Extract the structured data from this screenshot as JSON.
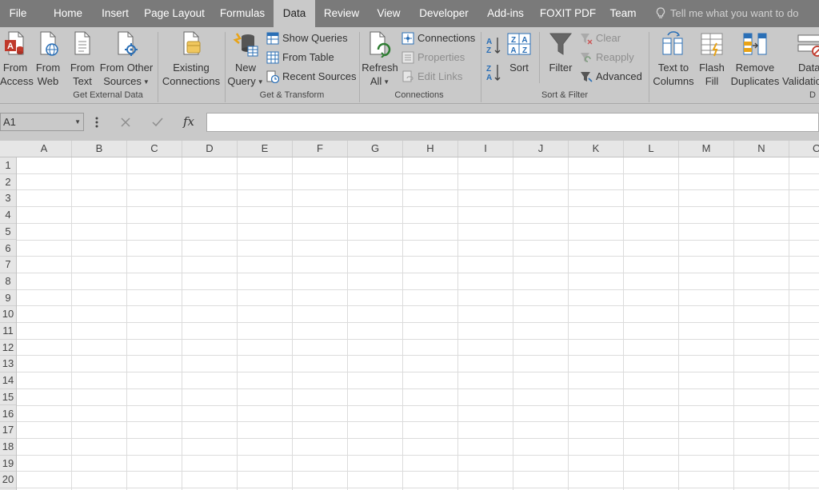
{
  "tabs": [
    {
      "label": "File",
      "active": false
    },
    {
      "label": "Home",
      "active": false
    },
    {
      "label": "Insert",
      "active": false
    },
    {
      "label": "Page Layout",
      "active": false
    },
    {
      "label": "Formulas",
      "active": false
    },
    {
      "label": "Data",
      "active": true
    },
    {
      "label": "Review",
      "active": false
    },
    {
      "label": "View",
      "active": false
    },
    {
      "label": "Developer",
      "active": false
    },
    {
      "label": "Add-ins",
      "active": false
    },
    {
      "label": "FOXIT PDF",
      "active": false
    },
    {
      "label": "Team",
      "active": false
    }
  ],
  "tell_me": "Tell me what you want to do",
  "ribbon": {
    "get_external_data": {
      "label": "Get External Data",
      "from_access": [
        "From",
        "Access"
      ],
      "from_web": [
        "From",
        "Web"
      ],
      "from_text": [
        "From",
        "Text"
      ],
      "from_other": [
        "From Other",
        "Sources"
      ],
      "existing": [
        "Existing",
        "Connections"
      ]
    },
    "get_transform": {
      "label": "Get & Transform",
      "new_query": [
        "New",
        "Query"
      ],
      "show_queries": "Show Queries",
      "from_table": "From Table",
      "recent_sources": "Recent Sources"
    },
    "connections": {
      "label": "Connections",
      "refresh_all": [
        "Refresh",
        "All"
      ],
      "connections": "Connections",
      "properties": "Properties",
      "edit_links": "Edit Links"
    },
    "sort_filter": {
      "label": "Sort & Filter",
      "sort": "Sort",
      "filter": "Filter",
      "clear": "Clear",
      "reapply": "Reapply",
      "advanced": "Advanced"
    },
    "data_tools": {
      "label": "D",
      "text_to_columns": [
        "Text to",
        "Columns"
      ],
      "flash_fill": [
        "Flash",
        "Fill"
      ],
      "remove_duplicates": [
        "Remove",
        "Duplicates"
      ],
      "data_validation": [
        "Data",
        "Validation"
      ]
    }
  },
  "formula_bar": {
    "name_box": "A1",
    "fx": "fx",
    "value": ""
  },
  "grid": {
    "columns": [
      "A",
      "B",
      "C",
      "D",
      "E",
      "F",
      "G",
      "H",
      "I",
      "J",
      "K",
      "L",
      "M",
      "N",
      "O"
    ],
    "rows": [
      "1",
      "2",
      "3",
      "4",
      "5",
      "6",
      "7",
      "8",
      "9",
      "10",
      "11",
      "12",
      "13",
      "14",
      "15",
      "16",
      "17",
      "18",
      "19",
      "20"
    ]
  },
  "colors": {
    "tab_bar": "#7a7a7a",
    "ribbon": "#c9c9c9",
    "access_red": "#c0392b",
    "excel_green": "#2e7d32",
    "icon_blue": "#2a6fb6"
  },
  "icons": {
    "tell_me": "lightbulb-icon",
    "name_box_dropdown": "chevron-down-icon",
    "cancel": "close-icon",
    "enter": "check-icon",
    "insert_function": "fx-icon"
  }
}
